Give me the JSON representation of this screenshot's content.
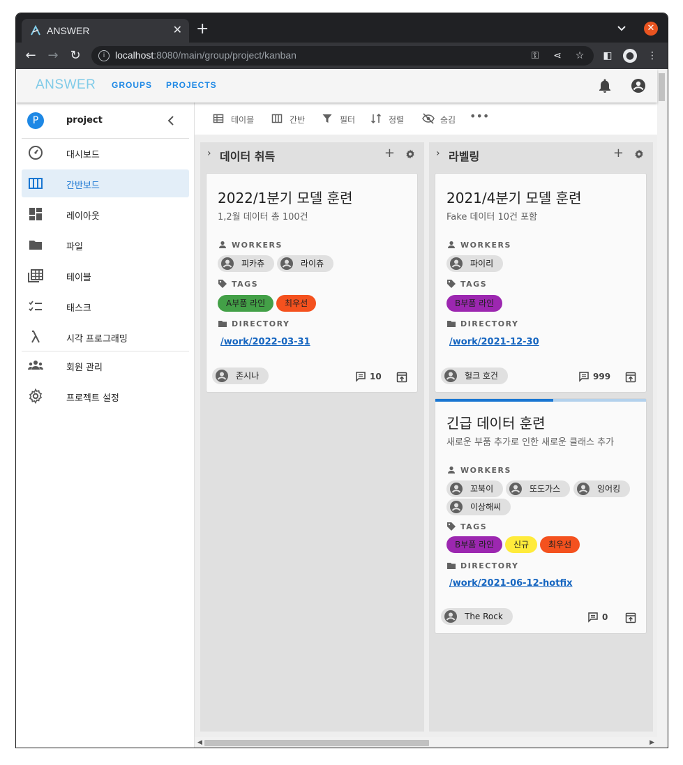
{
  "browser": {
    "tab_title": "ANSWER",
    "url_host": "localhost",
    "url_rest": ":8080/main/group/project/kanban"
  },
  "appbar": {
    "logo": "ANSWER",
    "nav_groups": "GROUPS",
    "nav_projects": "PROJECTS"
  },
  "sidebar": {
    "project_initial": "P",
    "project_name": "project",
    "items": [
      {
        "label": "대시보드",
        "icon": "dashboard-icon"
      },
      {
        "label": "간반보드",
        "icon": "kanban-icon",
        "active": true
      },
      {
        "label": "레이아웃",
        "icon": "layout-icon"
      },
      {
        "label": "파일",
        "icon": "folder-icon"
      },
      {
        "label": "테이블",
        "icon": "table-icon"
      },
      {
        "label": "태스크",
        "icon": "task-icon"
      },
      {
        "label": "시각 프로그래밍",
        "icon": "lambda-icon"
      },
      {
        "label": "회원 관리",
        "icon": "members-icon"
      },
      {
        "label": "프로젝트 설정",
        "icon": "settings-icon"
      }
    ]
  },
  "viewbar": {
    "table": "테이블",
    "kanban": "간반",
    "filter": "필터",
    "sort": "정렬",
    "hide": "숨김"
  },
  "columns": [
    {
      "title": "데이터 취득",
      "cards": [
        {
          "title": "2022/1분기 모델 훈련",
          "subtitle": "1,2월 데이터 총 100건",
          "workers_label": "WORKERS",
          "workers": [
            "피카츄",
            "라이츄"
          ],
          "tags_label": "TAGS",
          "tags": [
            {
              "name": "A부품 라인",
              "color": "#43a047"
            },
            {
              "name": "최우선",
              "color": "#f4511e"
            }
          ],
          "directory_label": "DIRECTORY",
          "directory": "/work/2022-03-31",
          "owner": "존시나",
          "comments": "10"
        }
      ]
    },
    {
      "title": "라벨링",
      "cards": [
        {
          "title": "2021/4분기 모델 훈련",
          "subtitle": "Fake 데이터 10건 포함",
          "workers_label": "WORKERS",
          "workers": [
            "파이리"
          ],
          "tags_label": "TAGS",
          "tags": [
            {
              "name": "B부품 라인",
              "color": "#9c27b0"
            }
          ],
          "directory_label": "DIRECTORY",
          "directory": "/work/2021-12-30",
          "owner": "헐크 호건",
          "comments": "999"
        },
        {
          "title": "긴급 데이터 훈련",
          "subtitle": "새로운 부품 추가로 인한 새로운 클래스 추가",
          "progress": 0.56,
          "workers_label": "WORKERS",
          "workers": [
            "꼬북이",
            "또도가스",
            "잉어킹",
            "이상해씨"
          ],
          "tags_label": "TAGS",
          "tags": [
            {
              "name": "B부품 라인",
              "color": "#9c27b0"
            },
            {
              "name": "신규",
              "color": "#ffeb3b"
            },
            {
              "name": "최우선",
              "color": "#f4511e"
            }
          ],
          "directory_label": "DIRECTORY",
          "directory": "/work/2021-06-12-hotfix",
          "owner": "The Rock",
          "comments": "0"
        }
      ]
    }
  ]
}
